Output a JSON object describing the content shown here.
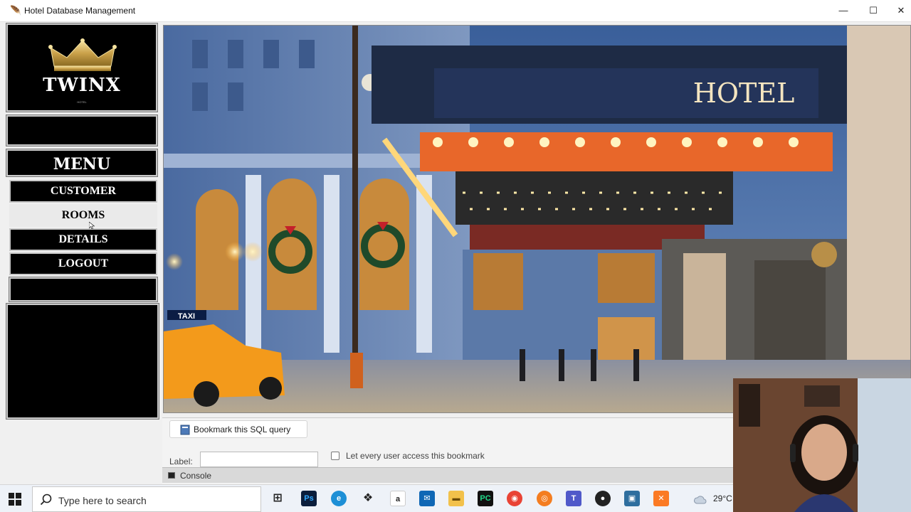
{
  "window": {
    "title": "Hotel Database Management",
    "minimize": "—",
    "maximize": "☐",
    "close": "✕"
  },
  "sidebar": {
    "logo_text": "TWINX",
    "logo_subtext": "HOTEL",
    "menu_title": "MENU",
    "items": [
      {
        "label": "CUSTOMER",
        "active": false
      },
      {
        "label": "ROOMS",
        "active": true
      },
      {
        "label": "DETAILS",
        "active": false
      },
      {
        "label": "LOGOUT",
        "active": false
      }
    ]
  },
  "hero": {
    "sign_text": "HOTEL",
    "taxi_text": "TAXI"
  },
  "lower_panel": {
    "bookmark_tab": "Bookmark this SQL query",
    "label_text": "Label:",
    "label_value": "",
    "checkbox_label": "Let every user access this bookmark",
    "console_label": "Console"
  },
  "taskbar": {
    "search_placeholder": "Type here to search",
    "temperature": "29°C",
    "apps": [
      "task-view",
      "photoshop",
      "edge",
      "dropbox",
      "amazon",
      "mail",
      "file-explorer",
      "pycharm",
      "chrome",
      "avast",
      "teams",
      "obs",
      "python",
      "xampp"
    ]
  },
  "colors": {
    "sidebar_bg": "#000000",
    "active_item_bg": "#eaeaea",
    "canopy_orange": "#e8672a",
    "taxi_yellow": "#f39a1b"
  }
}
